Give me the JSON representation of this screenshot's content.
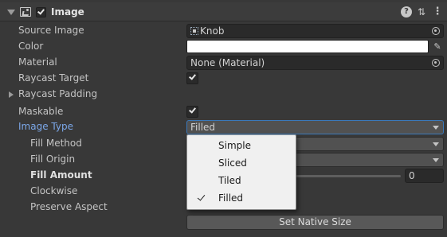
{
  "header": {
    "title": "Image",
    "enabled": true,
    "icons": [
      "foldout-arrow-icon",
      "image-component-icon",
      "help-icon",
      "presets-icon",
      "context-menu-icon"
    ]
  },
  "properties": {
    "source_image": {
      "label": "Source Image",
      "value": "Knob"
    },
    "color": {
      "label": "Color",
      "value": "#ffffff"
    },
    "material": {
      "label": "Material",
      "value": "None (Material)"
    },
    "raycast_target": {
      "label": "Raycast Target",
      "checked": true
    },
    "raycast_padding": {
      "label": "Raycast Padding",
      "expanded": false
    },
    "maskable": {
      "label": "Maskable",
      "checked": true
    },
    "image_type": {
      "label": "Image Type",
      "value": "Filled"
    },
    "fill_method": {
      "label": "Fill Method"
    },
    "fill_origin": {
      "label": "Fill Origin"
    },
    "fill_amount": {
      "label": "Fill Amount",
      "value": "0"
    },
    "clockwise": {
      "label": "Clockwise"
    },
    "preserve_aspect": {
      "label": "Preserve Aspect"
    }
  },
  "set_native_size_label": "Set Native Size",
  "image_type_popup": {
    "options": [
      "Simple",
      "Sliced",
      "Tiled",
      "Filled"
    ],
    "selected": "Filled"
  },
  "colors": {
    "panel_bg": "#383838",
    "accent_label": "#7ba7e8",
    "focus_border": "#3a79bb"
  }
}
